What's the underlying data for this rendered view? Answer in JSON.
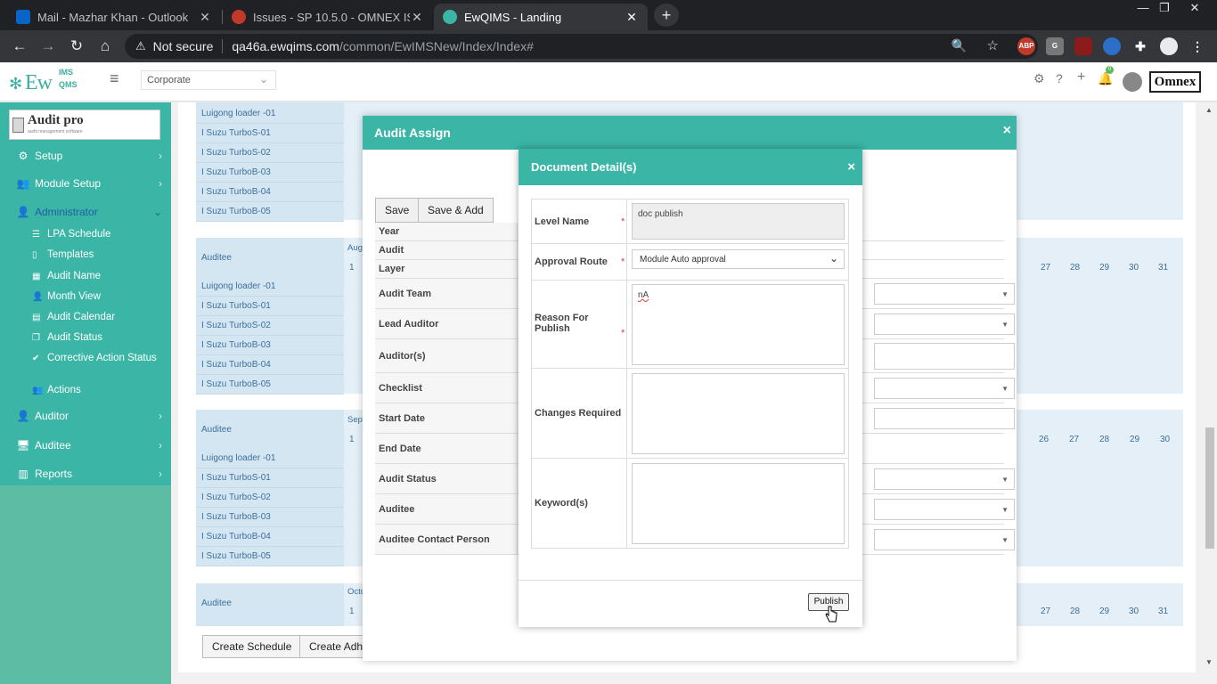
{
  "browser": {
    "tabs": [
      {
        "title": "Mail - Mazhar Khan - Outlook",
        "favicon_color": "#0a64c8"
      },
      {
        "title": "Issues - SP 10.5.0 - OMNEX ISSUE",
        "favicon_color": "#c0392b"
      },
      {
        "title": "EwQIMS - Landing",
        "favicon_color": "#3ab5a6"
      }
    ],
    "new_tab": "+",
    "address": {
      "security": "Not secure",
      "host": "qa46a.ewqims.com",
      "path": "/common/EwIMSNew/Index/Index#"
    },
    "extensions": [
      "ABP",
      "G"
    ]
  },
  "header": {
    "logo_main": "Ew",
    "logo_lms": "IMS",
    "logo_qms": "QMS",
    "site_select_value": "Corporate",
    "brand": "Omnex",
    "notification_count": "0"
  },
  "sidebar": {
    "auditpro_title": "Audit pro",
    "auditpro_sub": "audit management software",
    "items": [
      {
        "label": "Setup"
      },
      {
        "label": "Module Setup"
      },
      {
        "label": "Administrator"
      },
      {
        "label": "Auditor"
      },
      {
        "label": "Auditee"
      },
      {
        "label": "Reports"
      }
    ],
    "admin_sub": [
      {
        "label": "LPA Schedule"
      },
      {
        "label": "Templates"
      },
      {
        "label": "Audit Name"
      },
      {
        "label": "Month View"
      },
      {
        "label": "Audit Calendar"
      },
      {
        "label": "Audit Status"
      },
      {
        "label": "Corrective Action Status"
      },
      {
        "label": "Actions"
      }
    ]
  },
  "calendar": {
    "auditee_label": "Auditee",
    "rows": [
      "Luigong loader -01",
      "I Suzu TurboS-01",
      "I Suzu TurboS-02",
      "I Suzu TurboB-03",
      "I Suzu TurboB-04",
      "I Suzu TurboB-05"
    ],
    "months": [
      "Augus",
      "Septe",
      "Octob"
    ],
    "first_day": "1",
    "aug_tail_days": [
      "27",
      "28",
      "29",
      "30",
      "31"
    ],
    "sep_tail_days": [
      "26",
      "27",
      "28",
      "29",
      "30"
    ],
    "oct_tail_days": [
      "27",
      "28",
      "29",
      "30",
      "31"
    ]
  },
  "bottom": {
    "create_schedule": "Create Schedule",
    "create_adhoc": "Create Adhc"
  },
  "assign_modal": {
    "title": "Audit Assign",
    "close": "×",
    "save": "Save",
    "save_add": "Save & Add",
    "fields": [
      "Year",
      "Audit",
      "Layer",
      "Audit Team",
      "Lead Auditor",
      "Auditor(s)",
      "Checklist",
      "Start Date",
      "End Date",
      "Audit Status",
      "Auditee",
      "Auditee Contact Person"
    ]
  },
  "doc_modal": {
    "title": "Document Detail(s)",
    "close": "×",
    "level_name_label": "Level Name",
    "level_name_value": "doc publish",
    "approval_route_label": "Approval Route",
    "approval_route_value": "Module Auto approval",
    "reason_label": "Reason For Publish",
    "reason_value": "nA",
    "changes_label": "Changes Required",
    "changes_value": "",
    "keywords_label": "Keyword(s)",
    "keywords_value": "",
    "required_mark": "*",
    "publish": "Publish"
  }
}
